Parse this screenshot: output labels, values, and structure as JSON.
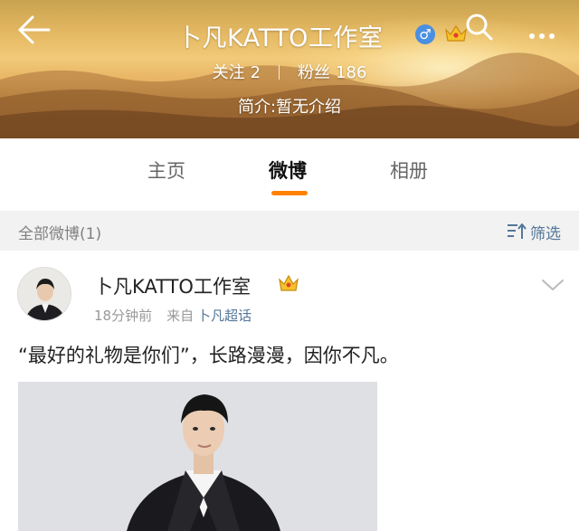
{
  "header": {
    "title": "卜凡KATTO工作室",
    "gender_symbol": "♂",
    "stats": {
      "following_label": "关注",
      "following_count": "2",
      "followers_label": "粉丝",
      "followers_count": "186"
    },
    "intro": "简介:暂无介绍",
    "icons": [
      "back-arrow-icon",
      "male-icon",
      "vip-crown-icon",
      "search-icon",
      "more-icon"
    ]
  },
  "tabs": [
    {
      "label": "主页",
      "active": false
    },
    {
      "label": "微博",
      "active": true
    },
    {
      "label": "相册",
      "active": false
    }
  ],
  "filter_bar": {
    "all_posts": "全部微博(1)",
    "filter_label": "筛选"
  },
  "post": {
    "author": "卜凡KATTO工作室",
    "time": "18分钟前",
    "source_prefix": "来自",
    "source": "卜凡超话",
    "text": "“最好的礼物是你们”，长路漫漫，因你不凡。"
  },
  "colors": {
    "accent_orange": "#ff8200",
    "link_blue": "#557799",
    "muted_gray": "#999999",
    "filter_bg": "#f2f2f2"
  }
}
